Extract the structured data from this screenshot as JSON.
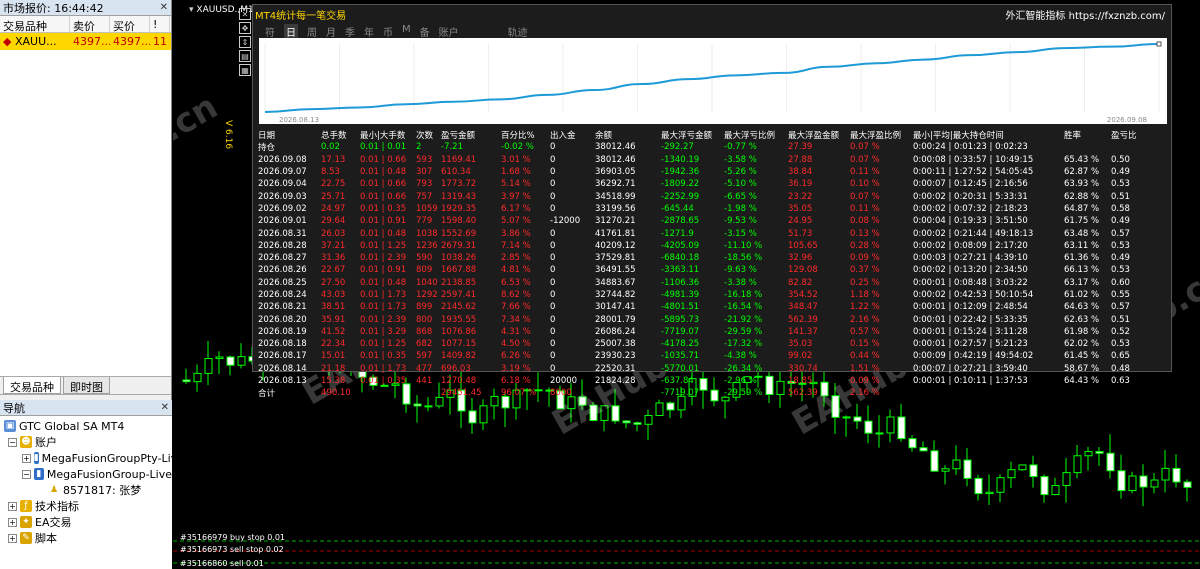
{
  "market_watch": {
    "title": "市场报价: 16:44:42",
    "columns": [
      "交易品种",
      "卖价",
      "买价",
      "!"
    ],
    "rows": [
      {
        "symbol": "XAUU...",
        "bid": "4397...",
        "ask": "4397...",
        "spread": "11"
      }
    ],
    "tabs": [
      "交易品种",
      "即时图"
    ]
  },
  "navigator": {
    "title": "导航",
    "items": [
      {
        "label": "GTC Global SA MT4",
        "level": 0,
        "icon": "broker-icon"
      },
      {
        "label": "账户",
        "level": 1,
        "icon": "accounts-icon"
      },
      {
        "label": "MegaFusionGroupPty-Live",
        "level": 2,
        "icon": "server-icon"
      },
      {
        "label": "MegaFusionGroup-Live",
        "level": 2,
        "icon": "server-icon"
      },
      {
        "label": "8571817: 张梦",
        "level": 3,
        "icon": "user-icon"
      },
      {
        "label": "技术指标",
        "level": 1,
        "icon": "indicator-icon"
      },
      {
        "label": "EA交易",
        "level": 1,
        "icon": "ea-icon"
      },
      {
        "label": "脚本",
        "level": 1,
        "icon": "script-icon"
      }
    ]
  },
  "chart": {
    "symbol": "XAUUSD.,M15",
    "side_label": "V 6.16",
    "orders": [
      "#35166979 buy stop 0.01",
      "#35166973 sell stop 0.02",
      "#35166860 sell 0.01"
    ],
    "watermark": "EAHub.cn"
  },
  "panel": {
    "title": "MT4统计每一笔交易",
    "link": "外汇智能指标 https://fxznzb.com/",
    "tabs": [
      "符",
      "日",
      "周",
      "月",
      "季",
      "年",
      "币",
      "M",
      "备",
      "账户",
      "轨迹"
    ],
    "active_tab": 1,
    "equity_start_date": "2026.08.13",
    "equity_end_date": "2026.09.08",
    "equity_color": "#1e9bd7",
    "headers": [
      "日期",
      "总手数",
      "最小|大手数",
      "次数",
      "盈亏金额",
      "百分比%",
      "出入金",
      "余额",
      "最大浮亏金额",
      "最大浮亏比例",
      "最大浮盈金额",
      "最大浮盈比例",
      "最小|平均|最大持仓时间",
      "胜率",
      "盈亏比"
    ],
    "position_row": [
      "持仓",
      "0.02",
      "0.01 | 0.01",
      "2",
      "-7.21",
      "-0.02 %",
      "0",
      "38012.46",
      "-292.27",
      "-0.77 %",
      "27.39",
      "0.07 %",
      "0:00:24 | 0:01:23 | 0:02:23",
      "",
      ""
    ],
    "rows": [
      [
        "2026.09.08",
        "17.13",
        "0.01 | 0.66",
        "593",
        "1169.41",
        "3.01 %",
        "0",
        "38012.46",
        "-1340.19",
        "-3.58 %",
        "27.88",
        "0.07 %",
        "0:00:08 | 0:33:57 | 10:49:15",
        "65.43 %",
        "0.50"
      ],
      [
        "2026.09.07",
        "8.53",
        "0.01 | 0.48",
        "307",
        "610.34",
        "1.68 %",
        "0",
        "36903.05",
        "-1942.36",
        "-5.26 %",
        "38.84",
        "0.11 %",
        "0:00:11 | 1:27:52 | 54:05:45",
        "62.87 %",
        "0.49"
      ],
      [
        "2026.09.04",
        "22.75",
        "0.01 | 0.66",
        "793",
        "1773.72",
        "5.14 %",
        "0",
        "36292.71",
        "-1809.22",
        "-5.10 %",
        "36.19",
        "0.10 %",
        "0:00:07 | 0:12:45 | 2:16:56",
        "63.93 %",
        "0.53"
      ],
      [
        "2026.09.03",
        "25.71",
        "0.01 | 0.66",
        "757",
        "1319.43",
        "3.97 %",
        "0",
        "34518.99",
        "-2252.99",
        "-6.65 %",
        "23.22",
        "0.07 %",
        "0:00:02 | 0:20:31 | 5:33:31",
        "62.88 %",
        "0.51"
      ],
      [
        "2026.09.02",
        "24.97",
        "0.01 | 0.35",
        "1059",
        "1929.35",
        "6.17 %",
        "0",
        "33199.56",
        "-645.44",
        "-1.98 %",
        "35.05",
        "0.11 %",
        "0:00:02 | 0:07:32 | 2:18:23",
        "64.87 %",
        "0.58"
      ],
      [
        "2026.09.01",
        "29.64",
        "0.01 | 0.91",
        "779",
        "1598.40",
        "5.07 %",
        "-12000",
        "31270.21",
        "-2878.65",
        "-9.53 %",
        "24.95",
        "0.08 %",
        "0:00:04 | 0:19:33 | 3:51:50",
        "61.75 %",
        "0.49"
      ],
      [
        "2026.08.31",
        "26.03",
        "0.01 | 0.48",
        "1038",
        "1552.69",
        "3.86 %",
        "0",
        "41761.81",
        "-1271.9",
        "-3.15 %",
        "51.73",
        "0.13 %",
        "0:00:02 | 0:21:44 | 49:18:13",
        "63.48 %",
        "0.57"
      ],
      [
        "2026.08.28",
        "37.21",
        "0.01 | 1.25",
        "1236",
        "2679.31",
        "7.14 %",
        "0",
        "40209.12",
        "-4205.09",
        "-11.10 %",
        "105.65",
        "0.28 %",
        "0:00:02 | 0:08:09 | 2:17:20",
        "63.11 %",
        "0.53"
      ],
      [
        "2026.08.27",
        "31.36",
        "0.01 | 2.39",
        "590",
        "1038.26",
        "2.85 %",
        "0",
        "37529.81",
        "-6840.18",
        "-18.56 %",
        "32.96",
        "0.09 %",
        "0:00:03 | 0:27:21 | 4:39:10",
        "61.36 %",
        "0.49"
      ],
      [
        "2026.08.26",
        "22.67",
        "0.01 | 0.91",
        "809",
        "1667.88",
        "4.81 %",
        "0",
        "36491.55",
        "-3363.11",
        "-9.63 %",
        "129.08",
        "0.37 %",
        "0:00:02 | 0:13:20 | 2:34:50",
        "66.13 %",
        "0.53"
      ],
      [
        "2026.08.25",
        "27.50",
        "0.01 | 0.48",
        "1040",
        "2138.85",
        "6.53 %",
        "0",
        "34883.67",
        "-1106.36",
        "-3.38 %",
        "82.82",
        "0.25 %",
        "0:00:01 | 0:08:48 | 3:03:22",
        "63.17 %",
        "0.60"
      ],
      [
        "2026.08.24",
        "43.03",
        "0.01 | 1.73",
        "1292",
        "2597.41",
        "8.62 %",
        "0",
        "32744.82",
        "-4981.39",
        "-16.18 %",
        "354.52",
        "1.18 %",
        "0:00:02 | 0:42:53 | 50:10:54",
        "61.02 %",
        "0.55"
      ],
      [
        "2026.08.21",
        "38.51",
        "0.01 | 1.73",
        "899",
        "2145.62",
        "7.66 %",
        "0",
        "30147.41",
        "-4801.51",
        "-16.54 %",
        "348.47",
        "1.22 %",
        "0:00:01 | 0:12:09 | 2:48:54",
        "64.63 %",
        "0.57"
      ],
      [
        "2026.08.20",
        "35.91",
        "0.01 | 2.39",
        "800",
        "1935.55",
        "7.34 %",
        "0",
        "28001.79",
        "-5895.73",
        "-21.92 %",
        "562.39",
        "2.16 %",
        "0:00:01 | 0:22:42 | 5:33:35",
        "62.63 %",
        "0.51"
      ],
      [
        "2026.08.19",
        "41.52",
        "0.01 | 3.29",
        "868",
        "1076.86",
        "4.31 %",
        "0",
        "26086.24",
        "-7719.07",
        "-29.59 %",
        "141.37",
        "0.57 %",
        "0:00:01 | 0:15:24 | 3:11:28",
        "61.98 %",
        "0.52"
      ],
      [
        "2026.08.18",
        "22.34",
        "0.01 | 1.25",
        "682",
        "1077.15",
        "4.50 %",
        "0",
        "25007.38",
        "-4178.25",
        "-17.32 %",
        "35.03",
        "0.15 %",
        "0:00:01 | 0:27:57 | 5:21:23",
        "62.02 %",
        "0.53"
      ],
      [
        "2026.08.17",
        "15.01",
        "0.01 | 0.35",
        "597",
        "1409.82",
        "6.26 %",
        "0",
        "23930.23",
        "-1035.71",
        "-4.38 %",
        "99.02",
        "0.44 %",
        "0:00:09 | 0:42:19 | 49:54:02",
        "61.45 %",
        "0.65"
      ],
      [
        "2026.08.14",
        "21.18",
        "0.01 | 1.73",
        "477",
        "696.03",
        "3.19 %",
        "0",
        "22520.31",
        "-5770.01",
        "-26.34 %",
        "330.74",
        "1.51 %",
        "0:00:07 | 0:27:21 | 3:59:40",
        "58.67 %",
        "0.48"
      ],
      [
        "2026.08.13",
        "15.38",
        "0.01 | 0.35",
        "441",
        "1270.48",
        "6.18 %",
        "20000",
        "21824.28",
        "-637.84",
        "-2.96 %",
        "18.85",
        "0.09 %",
        "0:00:01 | 0:10:11 | 1:37:53",
        "64.43 %",
        "0.63"
      ]
    ],
    "total_row": [
      "合计",
      "490.10",
      "",
      "",
      "29451.45",
      "96.07 %",
      "8000",
      "",
      "-7719.07",
      "-29.59 %",
      "562.39",
      "2.16 %",
      "",
      "",
      ""
    ],
    "equity": [
      21824.28,
      22520.31,
      23930.23,
      25007.38,
      26086.24,
      28001.79,
      30147.41,
      32744.82,
      34883.67,
      36491.55,
      37529.81,
      40209.12,
      41761.81,
      31270.21,
      33199.56,
      34518.99,
      36292.71,
      36903.05,
      38012.46
    ]
  }
}
